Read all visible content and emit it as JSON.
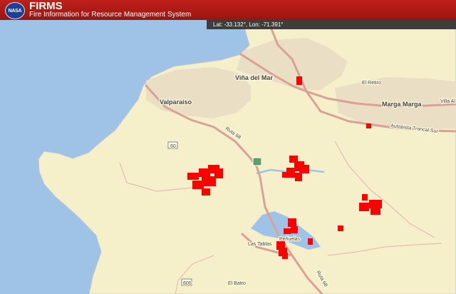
{
  "header": {
    "logo_text": "NASA",
    "title": "FIRMS",
    "subtitle": "Fire Information for Resource Management System"
  },
  "coordinates": {
    "readout": "Lat: -33.132°, Lon: -71.391°"
  },
  "map": {
    "labels": {
      "vina": "Viña del Mar",
      "valparaiso": "Valparaíso",
      "el_retiro": "El Retiro",
      "marga_marga": "Marga Marga",
      "villa_alemana": "Villa Al",
      "autopista": "Autopista Troncal Sur",
      "ruta68_north": "Ruta 68",
      "ruta68_south": "Ruta 68",
      "las_tablas": "Las Tablas",
      "penuelas": "Peñuelas",
      "el_batro": "El Batro",
      "route_f60": "60",
      "route_600": "600"
    },
    "colors": {
      "ocean": "#9fc3e6",
      "land": "#f5f0c9",
      "urban": "#eadfc4",
      "roads": "#d9a198",
      "fire": "#ff0000"
    }
  }
}
